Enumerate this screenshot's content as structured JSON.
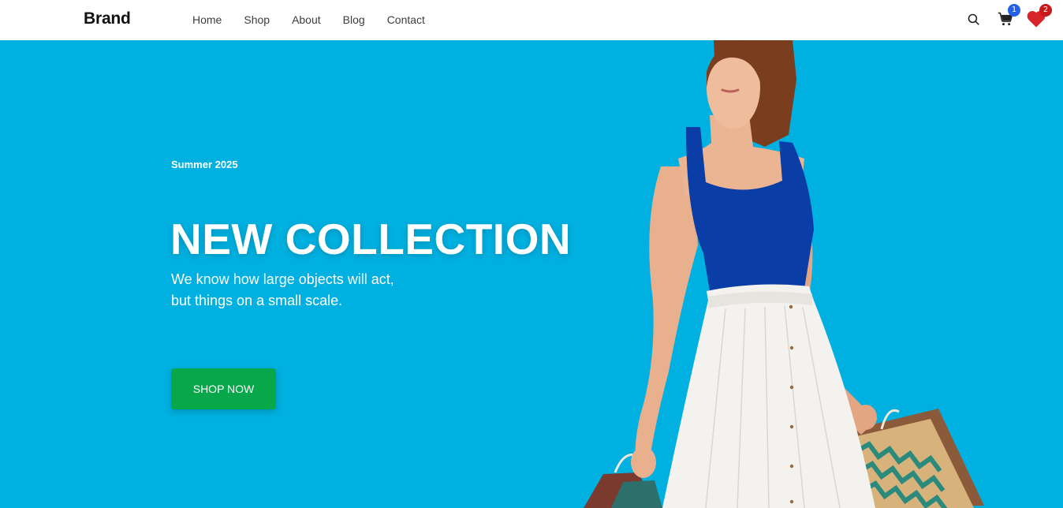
{
  "header": {
    "brand": "Brand",
    "nav": [
      {
        "label": "Home"
      },
      {
        "label": "Shop"
      },
      {
        "label": "About"
      },
      {
        "label": "Blog"
      },
      {
        "label": "Contact"
      }
    ],
    "icons": {
      "search": "search-icon",
      "cart": "cart-icon",
      "wishlist": "heart-icon"
    },
    "cart_count": "1",
    "wishlist_count": "2"
  },
  "hero": {
    "season": "Summer 2025",
    "title": "NEW COLLECTION",
    "subtitle_line1": "We know how large objects will act,",
    "subtitle_line2": "but things on a small scale.",
    "cta_label": "SHOP NOW",
    "background_color": "#00b0e0",
    "cta_color": "#08a74a"
  }
}
